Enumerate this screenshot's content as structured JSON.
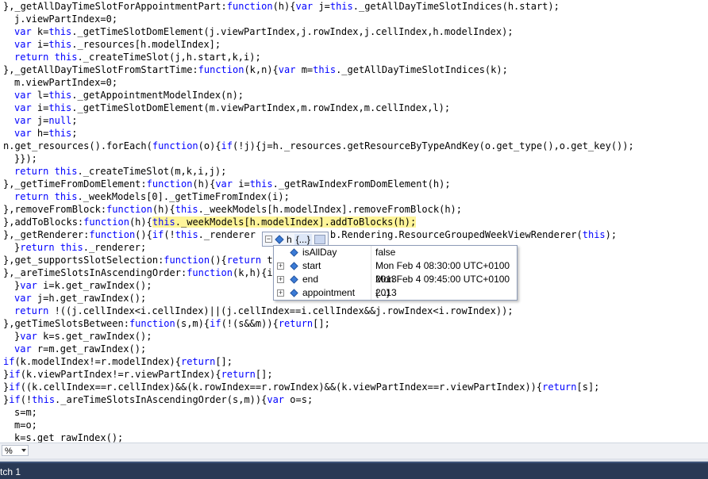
{
  "code_lines": [
    {
      "text": "},_getAllDayTimeSlotForAppointmentPart:function(h){var j=this._getAllDayTimeSlotIndices(h.start);",
      "indent": 0
    },
    {
      "text": "j.viewPartIndex=0;",
      "indent": 1
    },
    {
      "text": "var k=this._getTimeSlotDomElement(j.viewPartIndex,j.rowIndex,j.cellIndex,h.modelIndex);",
      "indent": 1
    },
    {
      "text": "var i=this._resources[h.modelIndex];",
      "indent": 1
    },
    {
      "text": "return this._createTimeSlot(j,h.start,k,i);",
      "indent": 1
    },
    {
      "text": "},_getAllDayTimeSlotFromStartTime:function(k,n){var m=this._getAllDayTimeSlotIndices(k);",
      "indent": 0
    },
    {
      "text": "m.viewPartIndex=0;",
      "indent": 1
    },
    {
      "text": "var l=this._getAppointmentModelIndex(n);",
      "indent": 1
    },
    {
      "text": "var i=this._getTimeSlotDomElement(m.viewPartIndex,m.rowIndex,m.cellIndex,l);",
      "indent": 1
    },
    {
      "text": "var j=null;",
      "indent": 1
    },
    {
      "text": "var h=this;",
      "indent": 1
    },
    {
      "text": "n.get_resources().forEach(function(o){if(!j){j=h._resources.getResourceByTypeAndKey(o.get_type(),o.get_key());",
      "indent": 0
    },
    {
      "text": "}});",
      "indent": 1
    },
    {
      "text": "return this._createTimeSlot(m,k,i,j);",
      "indent": 1
    },
    {
      "text": "},_getTimeFromDomElement:function(h){var i=this._getRawIndexFromDomElement(h);",
      "indent": 0
    },
    {
      "text": "return this._weekModels[0]._getTimeFromIndex(i);",
      "indent": 1
    },
    {
      "text": "},removeFromBlock:function(h){this._weekModels[h.modelIndex].removeFromBlock(h);",
      "indent": 0
    },
    {
      "text": "},addToBlocks:function(h){this._weekModels[h.modelIndex].addToBlocks(h);",
      "indent": 0
    },
    {
      "text": "},_getRenderer:function(){if(!this._renderer       r=new b.Rendering.ResourceGroupedWeekViewRenderer(this);",
      "indent": 0
    },
    {
      "text": "}return this._renderer;",
      "indent": 1
    },
    {
      "text": "},get_supportsSlotSelection:function(){return t",
      "indent": 0
    },
    {
      "text": "},_areTimeSlotsInAscendingOrder:function(k,h){i",
      "indent": 0
    },
    {
      "text": "}var i=k.get_rawIndex();",
      "indent": 1
    },
    {
      "text": "var j=h.get_rawIndex();",
      "indent": 1
    },
    {
      "text": "return !((j.cellIndex<i.cellIndex)||(j.cellIndex==i.cellIndex&&j.rowIndex<i.rowIndex));",
      "indent": 1
    },
    {
      "text": "},getTimeSlotsBetween:function(s,m){if(!(s&&m)){return[];",
      "indent": 0
    },
    {
      "text": "}var k=s.get_rawIndex();",
      "indent": 1
    },
    {
      "text": "var r=m.get_rawIndex();",
      "indent": 1
    },
    {
      "text": "if(k.modelIndex!=r.modelIndex){return[];",
      "indent": 0
    },
    {
      "text": "}if(k.viewPartIndex!=r.viewPartIndex){return[];",
      "indent": 0
    },
    {
      "text": "}if((k.cellIndex==r.cellIndex)&&(k.rowIndex==r.rowIndex)&&(k.viewPartIndex==r.viewPartIndex)){return[s];",
      "indent": 0
    },
    {
      "text": "}if(!this._areTimeSlotsInAscendingOrder(s,m)){var o=s;",
      "indent": 0
    },
    {
      "text": "s=m;",
      "indent": 1
    },
    {
      "text": "m=o;",
      "indent": 1
    },
    {
      "text": "k=s.get_rawIndex();",
      "indent": 1
    }
  ],
  "highlighted_expression": "this._weekModels[h.modelIndex].addToBlocks(h);",
  "datatip": {
    "variable": "h",
    "value_summary": "{...}",
    "rows": [
      {
        "name": "isAllDay",
        "value": "false",
        "expandable": false
      },
      {
        "name": "start",
        "value": "Mon Feb 4 08:30:00 UTC+0100 2013",
        "expandable": true
      },
      {
        "name": "end",
        "value": "Mon Feb 4 09:45:00 UTC+0100 2013",
        "expandable": true
      },
      {
        "name": "appointment",
        "value": "{...}",
        "expandable": true
      }
    ]
  },
  "zoom": {
    "value": "%"
  },
  "bottom_tab": {
    "label": "tch 1"
  },
  "colors": {
    "keyword": "#0000ff",
    "highlight": "#fff59a",
    "tool_window_bar": "#293955"
  }
}
